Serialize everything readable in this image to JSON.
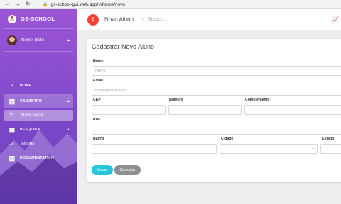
{
  "browser": {
    "url": "gs-school-gui.web.app/#/forms/novo"
  },
  "sidebar": {
    "brand": "GS-SCHOOL",
    "brand_logo_icon": "angular-logo-icon",
    "user_name": "Nome Teste",
    "items": [
      {
        "label": "HOME",
        "icon": "dashboard-icon"
      },
      {
        "label": "CADASTRO",
        "icon": "clipboard-icon"
      },
      {
        "abbr": "RF",
        "label": "Novo Aluno"
      },
      {
        "label": "PESQUISA",
        "icon": "search-list-icon"
      },
      {
        "abbr": "DT",
        "label": "Alunos"
      },
      {
        "label": "DOCUMENTATION",
        "icon": "book-icon"
      }
    ]
  },
  "topbar": {
    "badge": "E",
    "title": "Novo Aluno",
    "search_placeholder": "Search..."
  },
  "form": {
    "title": "Cadastrar Novo Aluno",
    "nome_label": "Nome",
    "nome_placeholder": "Nome",
    "email_label": "Email",
    "email_placeholder": "nome@email.com",
    "cep_label": "CEP",
    "numero_label": "Número",
    "complemento_label": "Complemento",
    "rua_label": "Rua",
    "bairro_label": "Bairro",
    "cidade_label": "Cidade",
    "estado_label": "Estado",
    "save_label": "Salvar",
    "cancel_label": "Cancelar"
  },
  "colors": {
    "sidebar": "#8c4fd0",
    "accent_save": "#26c6da",
    "badge": "#f44336"
  }
}
